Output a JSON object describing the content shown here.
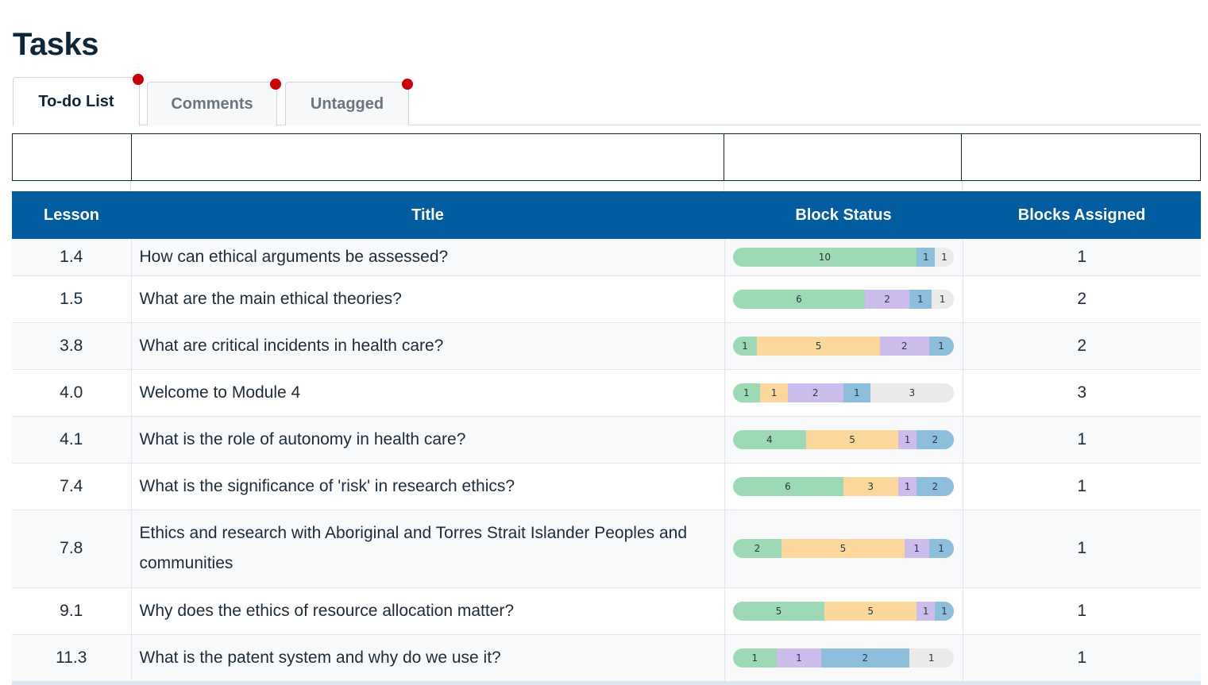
{
  "page": {
    "title": "Tasks"
  },
  "tabs": [
    {
      "label": "To-do List",
      "active": true,
      "has_notification": true
    },
    {
      "label": "Comments",
      "active": false,
      "has_notification": true
    },
    {
      "label": "Untagged",
      "active": false,
      "has_notification": true
    }
  ],
  "table": {
    "headers": {
      "lesson": "Lesson",
      "title": "Title",
      "block_status": "Block Status",
      "blocks_assigned": "Blocks Assigned"
    },
    "status_colors": {
      "green": "#9dd9b4",
      "orange": "#fdd89c",
      "purple": "#cdbdec",
      "blue": "#8dbedc",
      "gray": "#ebebeb"
    },
    "rows": [
      {
        "lesson": "1.4",
        "title": "How can ethical arguments be assessed?",
        "assigned": "1",
        "status": [
          {
            "color": "green",
            "value": 10
          },
          {
            "color": "blue",
            "value": 1
          },
          {
            "color": "gray",
            "value": 1
          }
        ]
      },
      {
        "lesson": "1.5",
        "title": "What are the main ethical theories?",
        "assigned": "2",
        "status": [
          {
            "color": "green",
            "value": 6
          },
          {
            "color": "purple",
            "value": 2
          },
          {
            "color": "blue",
            "value": 1
          },
          {
            "color": "gray",
            "value": 1
          }
        ]
      },
      {
        "lesson": "3.8",
        "title": "What are critical incidents in health care?",
        "assigned": "2",
        "status": [
          {
            "color": "green",
            "value": 1
          },
          {
            "color": "orange",
            "value": 5
          },
          {
            "color": "purple",
            "value": 2
          },
          {
            "color": "blue",
            "value": 1
          }
        ]
      },
      {
        "lesson": "4.0",
        "title": "Welcome to Module 4",
        "assigned": "3",
        "status": [
          {
            "color": "green",
            "value": 1
          },
          {
            "color": "orange",
            "value": 1
          },
          {
            "color": "purple",
            "value": 2
          },
          {
            "color": "blue",
            "value": 1
          },
          {
            "color": "gray",
            "value": 3
          }
        ]
      },
      {
        "lesson": "4.1",
        "title": "What is the role of autonomy in health care?",
        "assigned": "1",
        "status": [
          {
            "color": "green",
            "value": 4
          },
          {
            "color": "orange",
            "value": 5
          },
          {
            "color": "purple",
            "value": 1
          },
          {
            "color": "blue",
            "value": 2
          }
        ]
      },
      {
        "lesson": "7.4",
        "title": "What is the significance of 'risk' in research ethics?",
        "assigned": "1",
        "status": [
          {
            "color": "green",
            "value": 6
          },
          {
            "color": "orange",
            "value": 3
          },
          {
            "color": "purple",
            "value": 1
          },
          {
            "color": "blue",
            "value": 2
          }
        ]
      },
      {
        "lesson": "7.8",
        "title": "Ethics and research with Aboriginal and Torres Strait Islander Peoples and communities",
        "assigned": "1",
        "status": [
          {
            "color": "green",
            "value": 2
          },
          {
            "color": "orange",
            "value": 5
          },
          {
            "color": "purple",
            "value": 1
          },
          {
            "color": "blue",
            "value": 1
          }
        ]
      },
      {
        "lesson": "9.1",
        "title": "Why does the ethics of resource allocation matter?",
        "assigned": "1",
        "status": [
          {
            "color": "green",
            "value": 5
          },
          {
            "color": "orange",
            "value": 5
          },
          {
            "color": "purple",
            "value": 1
          },
          {
            "color": "blue",
            "value": 1
          }
        ]
      },
      {
        "lesson": "11.3",
        "title": "What is the patent system and why do we use it?",
        "assigned": "1",
        "status": [
          {
            "color": "green",
            "value": 1
          },
          {
            "color": "purple",
            "value": 1
          },
          {
            "color": "blue",
            "value": 2
          },
          {
            "color": "gray",
            "value": 1
          }
        ]
      }
    ]
  }
}
